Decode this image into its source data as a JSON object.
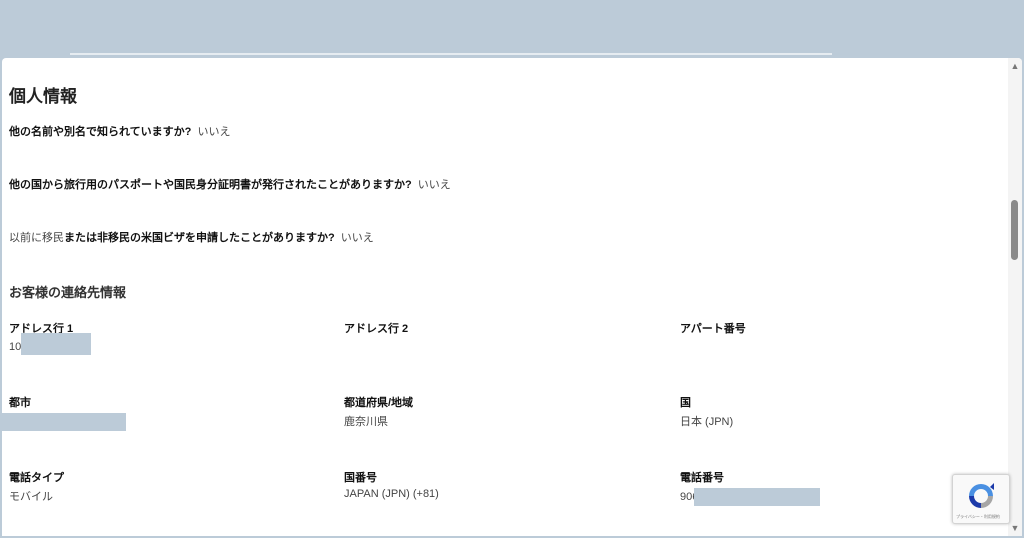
{
  "personal": {
    "title": "個人情報",
    "q1": {
      "question": "他の名前や別名で知られていますか?",
      "answer": "いいえ"
    },
    "q2": {
      "question": "他の国から旅行用のパスポートや国民身分証明書が発行されたことがありますか?",
      "answer": "いいえ"
    },
    "q3": {
      "question_prefix": "以前に移民",
      "question": "または非移民の米国ビザを申請したことがありますか?",
      "answer": "いいえ"
    }
  },
  "contact": {
    "title": "お客様の連絡先情報",
    "address1": {
      "label": "アドレス行 1",
      "value": "10"
    },
    "address2": {
      "label": "アドレス行 2",
      "value": ""
    },
    "apartment": {
      "label": "アパート番号",
      "value": ""
    },
    "city": {
      "label": "都市",
      "value": ""
    },
    "prefecture": {
      "label": "都道府県/地域",
      "value": "鹿奈川県"
    },
    "country": {
      "label": "国",
      "value": "日本 (JPN)"
    },
    "phone_type": {
      "label": "電話タイプ",
      "value": "モバイル"
    },
    "country_code": {
      "label": "国番号",
      "value": "JAPAN (JPN) (+81)"
    },
    "phone": {
      "label": "電話番号",
      "value": "906"
    }
  },
  "recaptcha": {
    "text": "プライバシー・利用規約"
  },
  "icons": {
    "scroll_up": "scroll-up-icon",
    "scroll_down": "scroll-down-icon",
    "recaptcha": "recaptcha-icon"
  },
  "colors": {
    "redaction": "#bccbd8",
    "panel": "#ffffff"
  }
}
